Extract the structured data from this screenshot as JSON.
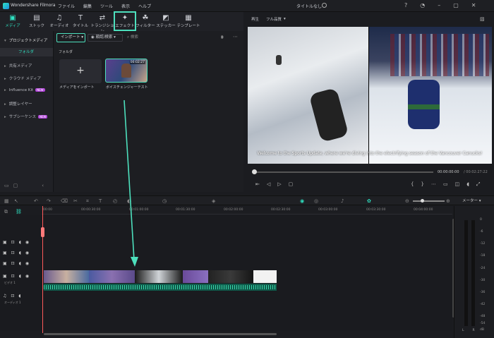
{
  "titlebar": {
    "app_name": "Wondershare Filmora",
    "menu": [
      "ファイル",
      "編集",
      "ツール",
      "表示",
      "ヘルプ"
    ],
    "project_title": "タイトルなし"
  },
  "toolbar": {
    "tabs": [
      {
        "label": "メディア"
      },
      {
        "label": "ストック"
      },
      {
        "label": "オーディオ"
      },
      {
        "label": "タイトル"
      },
      {
        "label": "トランジション"
      },
      {
        "label": "エフェクト"
      },
      {
        "label": "フィルター"
      },
      {
        "label": "ステッカー"
      },
      {
        "label": "テンプレート"
      }
    ],
    "active": "エフェクト",
    "highlight_color": "#4de0bd"
  },
  "sidebar": {
    "items": [
      {
        "label": "プロジェクトメディア"
      },
      {
        "label": "フォルダ"
      },
      {
        "label": "共有メディア"
      },
      {
        "label": "クラウド メディア"
      },
      {
        "label": "Influence Kit",
        "badge": "NEW"
      },
      {
        "label": "調整レイヤー"
      },
      {
        "label": "サブシーケンス",
        "badge": "NEW"
      }
    ]
  },
  "media": {
    "import_label": "インポート",
    "recognition_label": "顔認/検索",
    "search_placeholder": "検索",
    "folder_label": "フォルダ",
    "import_tile_label": "メディアをインポート",
    "clip_name": "ボイスチェンジャーテスト",
    "clip_duration": "00:02:27"
  },
  "preview": {
    "play_label": "再生",
    "quality_label": "フル品質",
    "caption": "Welcome to the Sports Update, where we're diving into the electrifying season of the Vancouver Canucks!",
    "current_time": "00:00:00:00",
    "total_time": "/ 00:02:27:22"
  },
  "timeline": {
    "ruler_ticks": [
      "00:00",
      "00:00:30:00",
      "00:01:00:00",
      "00:01:30:00",
      "00:02:00:00",
      "00:02:30:00",
      "00:03:00:00",
      "00:03:30:00",
      "00:04:00:00"
    ],
    "video_track_label": "ビデオ 1",
    "audio_track_label": "オーディオ 1",
    "meter_label": "メーター"
  },
  "meter": {
    "ticks": [
      "0",
      "-6",
      "-12",
      "-18",
      "-24",
      "-30",
      "-36",
      "-42",
      "-48",
      "-54",
      "dB"
    ],
    "left": "L",
    "right": "R"
  },
  "colors": {
    "accent": "#2fe2c2",
    "annotation": "#4de0bd",
    "playhead": "#ff5a5a"
  }
}
